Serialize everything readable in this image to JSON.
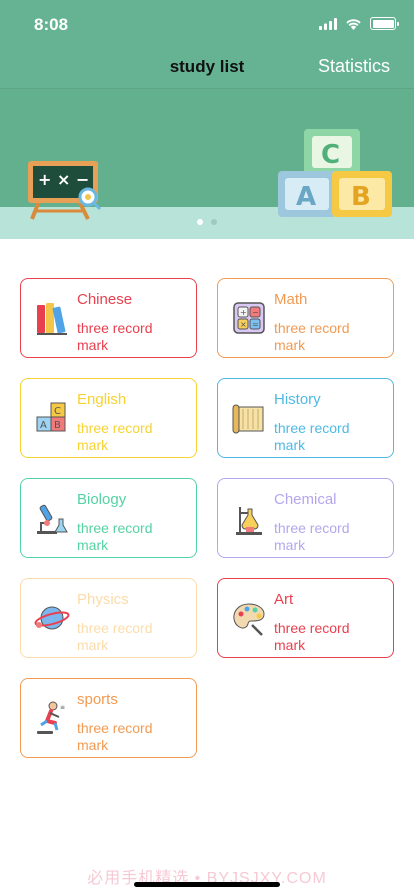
{
  "status": {
    "time": "8:08"
  },
  "nav": {
    "title": "study list",
    "right": "Statistics"
  },
  "subjects": [
    {
      "name": "Chinese",
      "record": "three record mark",
      "color": "#e8404f",
      "icon": "books-icon"
    },
    {
      "name": "Math",
      "record": "three record mark",
      "color": "#f29a52",
      "icon": "calculator-icon"
    },
    {
      "name": "English",
      "record": "three record mark",
      "color": "#f6d233",
      "icon": "abc-blocks-icon"
    },
    {
      "name": "History",
      "record": "three record mark",
      "color": "#4fb9e6",
      "icon": "scroll-icon"
    },
    {
      "name": "Biology",
      "record": "three record mark",
      "color": "#55d2a3",
      "icon": "microscope-icon"
    },
    {
      "name": "Chemical",
      "record": "three record mark",
      "color": "#b4a6ee",
      "icon": "flask-icon"
    },
    {
      "name": "Physics",
      "record": "three record mark",
      "color": "#fbdcaa",
      "icon": "planet-icon"
    },
    {
      "name": "Art",
      "record": "three record mark",
      "color": "#e8404f",
      "icon": "palette-icon"
    },
    {
      "name": "sports",
      "record": "three record mark",
      "color": "#f29a52",
      "icon": "runner-icon"
    }
  ],
  "watermark": "必用手机精选 • BYJSJXY.COM"
}
